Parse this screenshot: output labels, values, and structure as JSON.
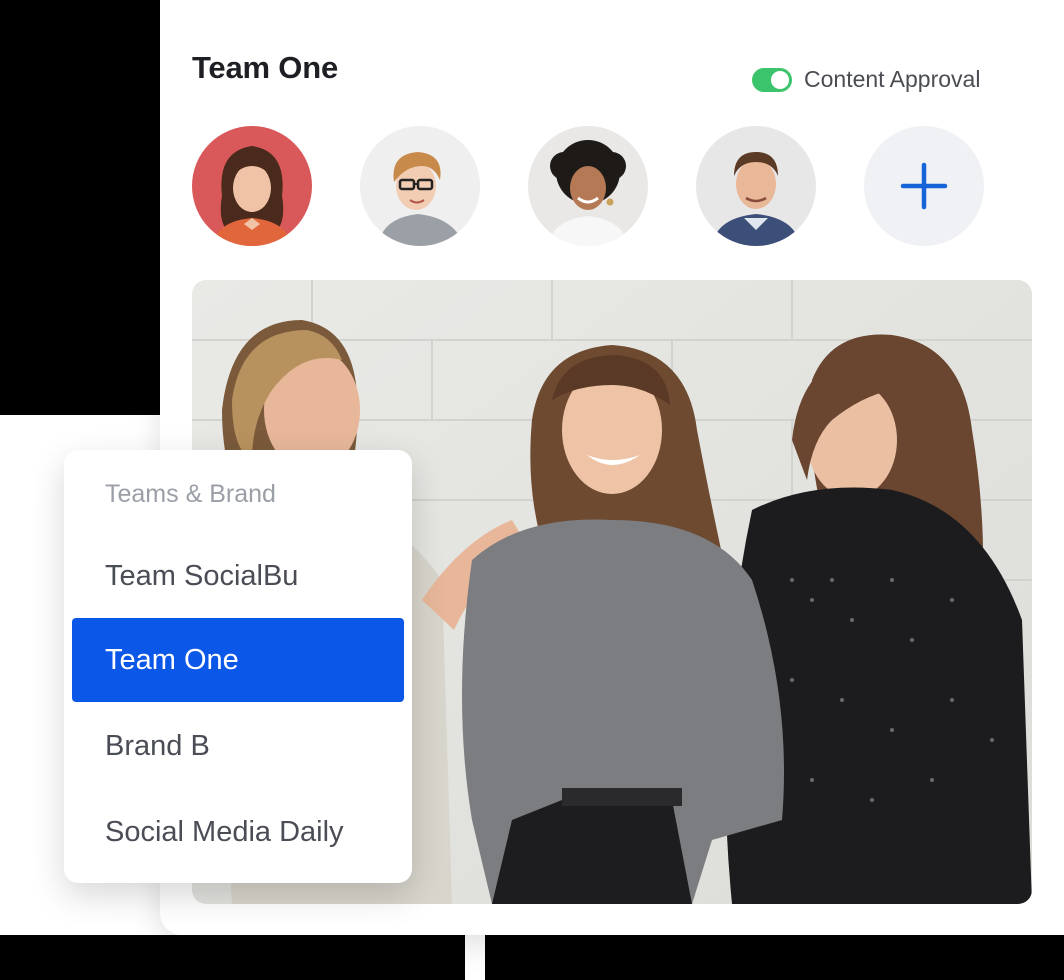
{
  "card": {
    "title": "Team One",
    "content_approval": {
      "label": "Content Approval",
      "enabled": true
    }
  },
  "members": [
    {
      "name": "member-avatar-1",
      "bg": "#d9585a"
    },
    {
      "name": "member-avatar-2",
      "bg": "#efefef"
    },
    {
      "name": "member-avatar-3",
      "bg": "#eae8e6"
    },
    {
      "name": "member-avatar-4",
      "bg": "#e7e7e7"
    }
  ],
  "add_member_icon": "plus-icon",
  "dropdown": {
    "heading": "Teams & Brand",
    "items": [
      {
        "label": "Team SocialBu",
        "selected": false
      },
      {
        "label": "Team One",
        "selected": true
      },
      {
        "label": "Brand B",
        "selected": false
      },
      {
        "label": "Social Media Daily",
        "selected": false
      }
    ]
  },
  "colors": {
    "accent": "#0b57e8",
    "toggle_on": "#3cc46c",
    "plus_icon": "#1565d8"
  }
}
